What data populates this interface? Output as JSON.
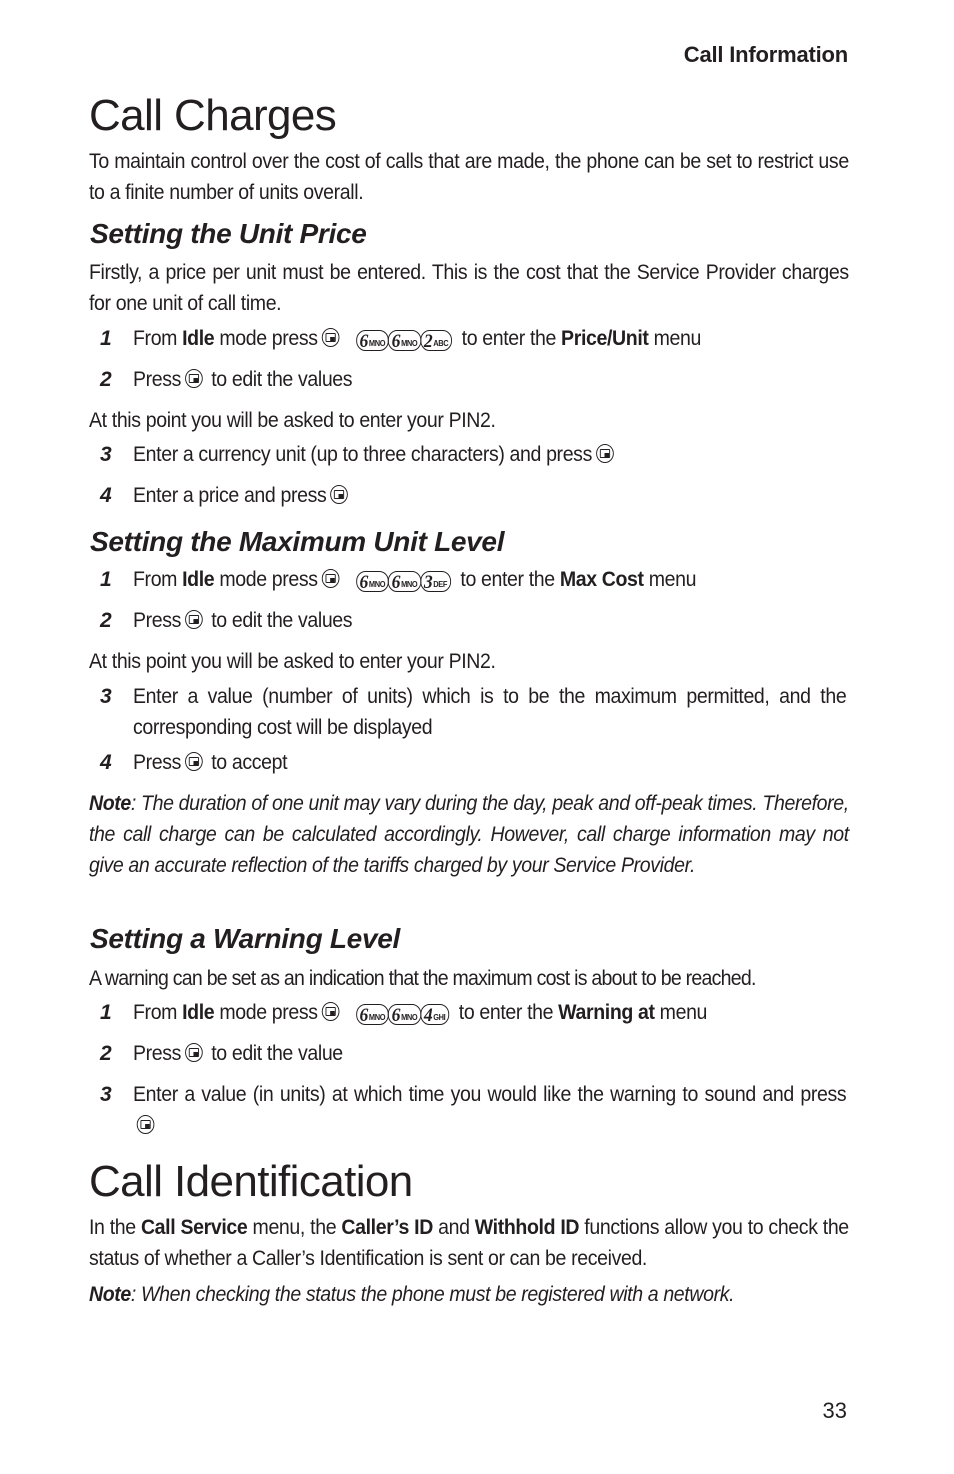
{
  "running_head": "Call Information",
  "page_number": "33",
  "icons": {
    "softkey": "softkey-icon",
    "keypad": "keypad-key-icon"
  },
  "call_charges": {
    "title": "Call Charges",
    "intro": "To maintain control over the cost of calls that are made, the phone can be set to restrict use to a finite number of units overall.",
    "unit_price": {
      "heading": "Setting the Unit Price",
      "intro": "Firstly, a price per unit must be entered. This is the cost that the Service Provider charges for one unit of call time.",
      "steps": [
        {
          "num": "1",
          "pre": "From ",
          "bold1": "Idle",
          "mid": " mode press",
          "keys": [
            [
              "6",
              "MNO"
            ],
            [
              "6",
              "MNO"
            ],
            [
              "2",
              "ABC"
            ]
          ],
          "post": " to enter the ",
          "bold2": "Price/Unit",
          "end": " menu"
        },
        {
          "num": "2",
          "pre": "Press",
          "post": " to edit the values"
        }
      ],
      "pin_text": "At this point you will be asked to enter your PIN2.",
      "steps2": [
        {
          "num": "3",
          "text": "Enter a currency unit (up to three characters) and press"
        },
        {
          "num": "4",
          "text": "Enter a price and press"
        }
      ]
    },
    "max_unit": {
      "heading": "Setting the Maximum Unit Level",
      "steps": [
        {
          "num": "1",
          "pre": "From ",
          "bold1": "Idle",
          "mid": " mode press",
          "keys": [
            [
              "6",
              "MNO"
            ],
            [
              "6",
              "MNO"
            ],
            [
              "3",
              "DEF"
            ]
          ],
          "post": " to enter the ",
          "bold2": "Max Cost",
          "end": " menu"
        },
        {
          "num": "2",
          "pre": "Press",
          "post": " to edit the values"
        }
      ],
      "pin_text": "At this point you will be asked to enter your PIN2.",
      "step3": {
        "num": "3",
        "text": "Enter a value (number of units) which is to be the maximum permitted, and the corresponding cost will be displayed"
      },
      "step4": {
        "num": "4",
        "pre": "Press",
        "post": " to accept"
      },
      "note_label": "Note",
      "note_text": ": The duration of one unit may vary during the day, peak and off-peak times. Therefore, the call charge can be calculated accordingly. However, call charge information may not give an accurate reflection of the tariffs charged by your Service Provider."
    },
    "warning": {
      "heading": "Setting a Warning Level",
      "intro": "A warning can be set as an indication that the maximum cost is about to be reached.",
      "steps": [
        {
          "num": "1",
          "pre": "From ",
          "bold1": "Idle",
          "mid": " mode press",
          "keys": [
            [
              "6",
              "MNO"
            ],
            [
              "6",
              "MNO"
            ],
            [
              "4",
              "GHI"
            ]
          ],
          "post": " to enter the ",
          "bold2": "Warning at",
          "end": " menu"
        },
        {
          "num": "2",
          "pre": "Press",
          "post": " to edit the value"
        }
      ],
      "step3": {
        "num": "3",
        "text": "Enter a value (in units) at which time you would like the warning to sound and press"
      }
    }
  },
  "call_identification": {
    "title": "Call Identification",
    "p_pre": "In the ",
    "b1": "Call Service",
    "p_mid1": " menu, the ",
    "b2": "Caller’s ID",
    "p_mid2": " and ",
    "b3": "Withhold ID",
    "p_end": " functions allow you to check the status of whether a Caller’s Identification is sent or can be received.",
    "note_label": "Note",
    "note_text": ": When checking the status the phone must be registered with a network."
  }
}
